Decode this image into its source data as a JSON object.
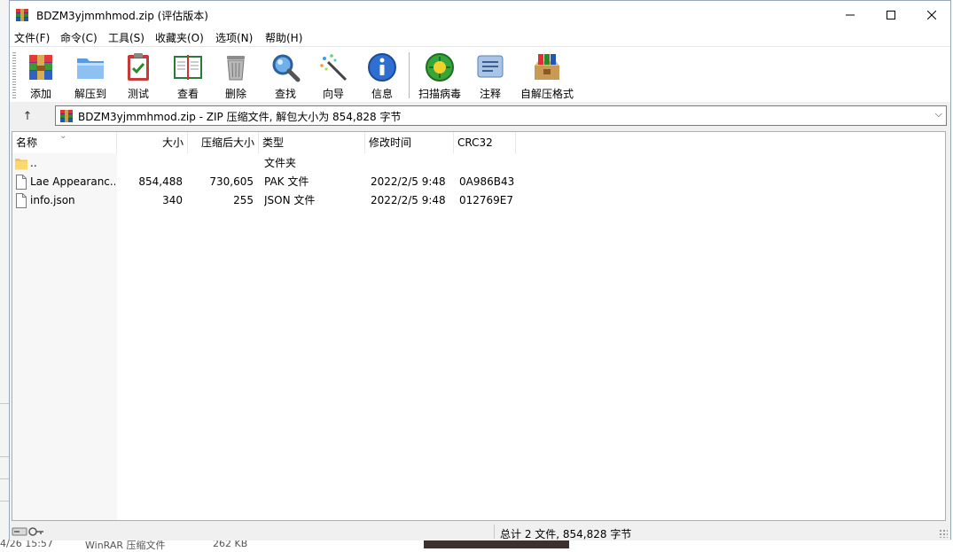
{
  "window": {
    "title": "BDZM3yjmmhmod.zip (评估版本)",
    "controls": {
      "minimize": "minimize",
      "maximize": "maximize",
      "close": "close"
    }
  },
  "menu": [
    {
      "label": "文件(F)"
    },
    {
      "label": "命令(C)"
    },
    {
      "label": "工具(S)"
    },
    {
      "label": "收藏夹(O)"
    },
    {
      "label": "选项(N)"
    },
    {
      "label": "帮助(H)"
    }
  ],
  "toolbar": {
    "buttons": [
      {
        "label": "添加",
        "icon": "archive-add-icon"
      },
      {
        "label": "解压到",
        "icon": "folder-extract-icon"
      },
      {
        "label": "测试",
        "icon": "clipboard-test-icon"
      },
      {
        "label": "查看",
        "icon": "book-view-icon"
      },
      {
        "label": "删除",
        "icon": "trash-icon"
      },
      {
        "label": "查找",
        "icon": "magnifier-icon"
      },
      {
        "label": "向导",
        "icon": "magic-wand-icon"
      },
      {
        "label": "信息",
        "icon": "info-icon"
      },
      {
        "label": "扫描病毒",
        "icon": "virus-scan-icon"
      },
      {
        "label": "注释",
        "icon": "comment-icon"
      },
      {
        "label": "自解压格式",
        "icon": "sfx-archive-icon"
      }
    ]
  },
  "address": {
    "text": "BDZM3yjmmhmod.zip - ZIP 压缩文件, 解包大小为 854,828 字节",
    "up_icon": "up-arrow-icon"
  },
  "columns": [
    {
      "key": "name",
      "label": "名称"
    },
    {
      "key": "size",
      "label": "大小"
    },
    {
      "key": "packed",
      "label": "压缩后大小"
    },
    {
      "key": "type",
      "label": "类型"
    },
    {
      "key": "modified",
      "label": "修改时间"
    },
    {
      "key": "crc",
      "label": "CRC32"
    }
  ],
  "files": [
    {
      "name": "..",
      "size": "",
      "packed": "",
      "type": "文件夹",
      "modified": "",
      "crc": "",
      "icon": "folder-icon"
    },
    {
      "name": "Lae Appearanc...",
      "size": "854,488",
      "packed": "730,605",
      "type": "PAK 文件",
      "modified": "2022/2/5 9:48",
      "crc": "0A986B43",
      "icon": "file-icon"
    },
    {
      "name": "info.json",
      "size": "340",
      "packed": "255",
      "type": "JSON 文件",
      "modified": "2022/2/5 9:48",
      "crc": "012769E7",
      "icon": "file-icon"
    }
  ],
  "status": {
    "text": "总计 2 文件, 854,828 字节"
  },
  "background": {
    "bottom_items": [
      {
        "text": "4/26 15:57"
      },
      {
        "text": "WinRAR 压缩文件"
      },
      {
        "text": "262 KB"
      }
    ]
  },
  "colors": {
    "window_bg": "#f0f0f0",
    "list_bg": "#ffffff",
    "border": "#adadad",
    "accent": "#1e5aa8"
  }
}
